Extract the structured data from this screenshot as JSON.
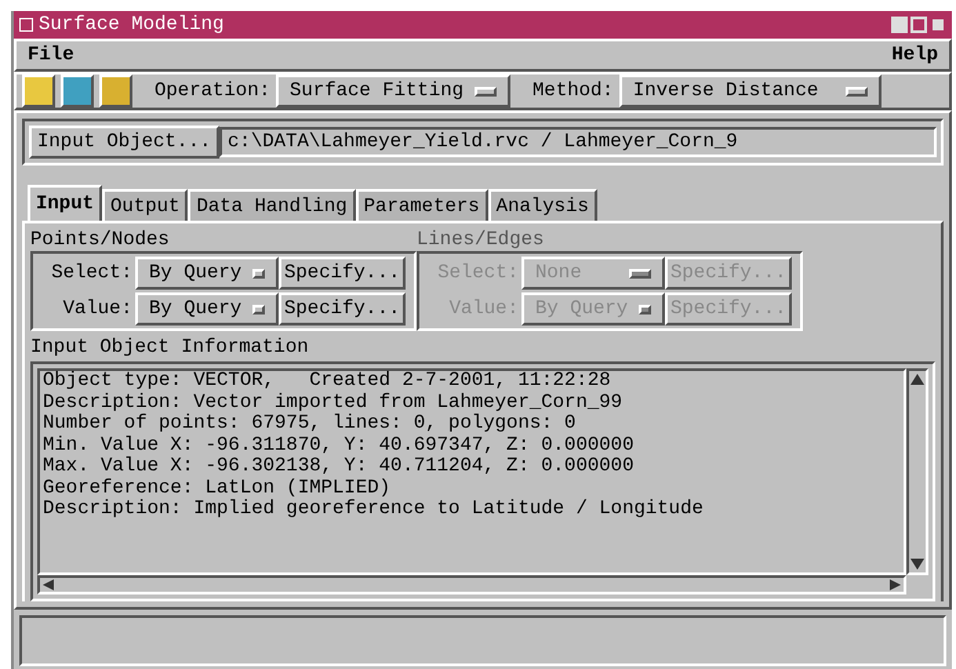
{
  "window": {
    "title": "Surface Modeling"
  },
  "menu": [
    "File",
    "Help"
  ],
  "toolbar": {
    "operation_label": "Operation:",
    "operation": "Surface Fitting",
    "method_label": "Method:",
    "method": "Inverse Distance"
  },
  "input_object": {
    "button": "Input Object...",
    "value": "c:\\DATA\\Lahmeyer_Yield.rvc / Lahmeyer_Corn_9"
  },
  "tabs": [
    {
      "label": "Input",
      "selected": true
    },
    {
      "label": "Output",
      "selected": false
    },
    {
      "label": "Data Handling",
      "selected": false
    },
    {
      "label": "Parameters",
      "selected": false
    },
    {
      "label": "Analysis",
      "selected": false
    }
  ],
  "groups": [
    {
      "title": "Points/Nodes",
      "disabled": false,
      "rows": [
        {
          "label": "Select:",
          "value": "By Query",
          "button": "Specify..."
        },
        {
          "label": "Value:",
          "value": "By Query",
          "button": "Specify..."
        }
      ]
    },
    {
      "title": "Lines/Edges",
      "disabled": true,
      "rows": [
        {
          "label": "Select:",
          "value": "None",
          "button": "Specify..."
        },
        {
          "label": "Value:",
          "value": "By Query",
          "button": "Specify..."
        }
      ]
    }
  ],
  "info": {
    "title": "Input Object Information",
    "lines": [
      "Object type: VECTOR,   Created 2-7-2001, 11:22:28",
      "Description: Vector imported from Lahmeyer_Corn_99",
      "Number of points: 67975, lines: 0, polygons: 0",
      "Min. Value X: -96.311870, Y: 40.697347, Z: 0.000000",
      "Max. Value X: -96.302138, Y: 40.711204, Z: 0.000000",
      "Georeference: LatLon (IMPLIED)",
      "Description: Implied georeference to Latitude / Longitude"
    ]
  }
}
